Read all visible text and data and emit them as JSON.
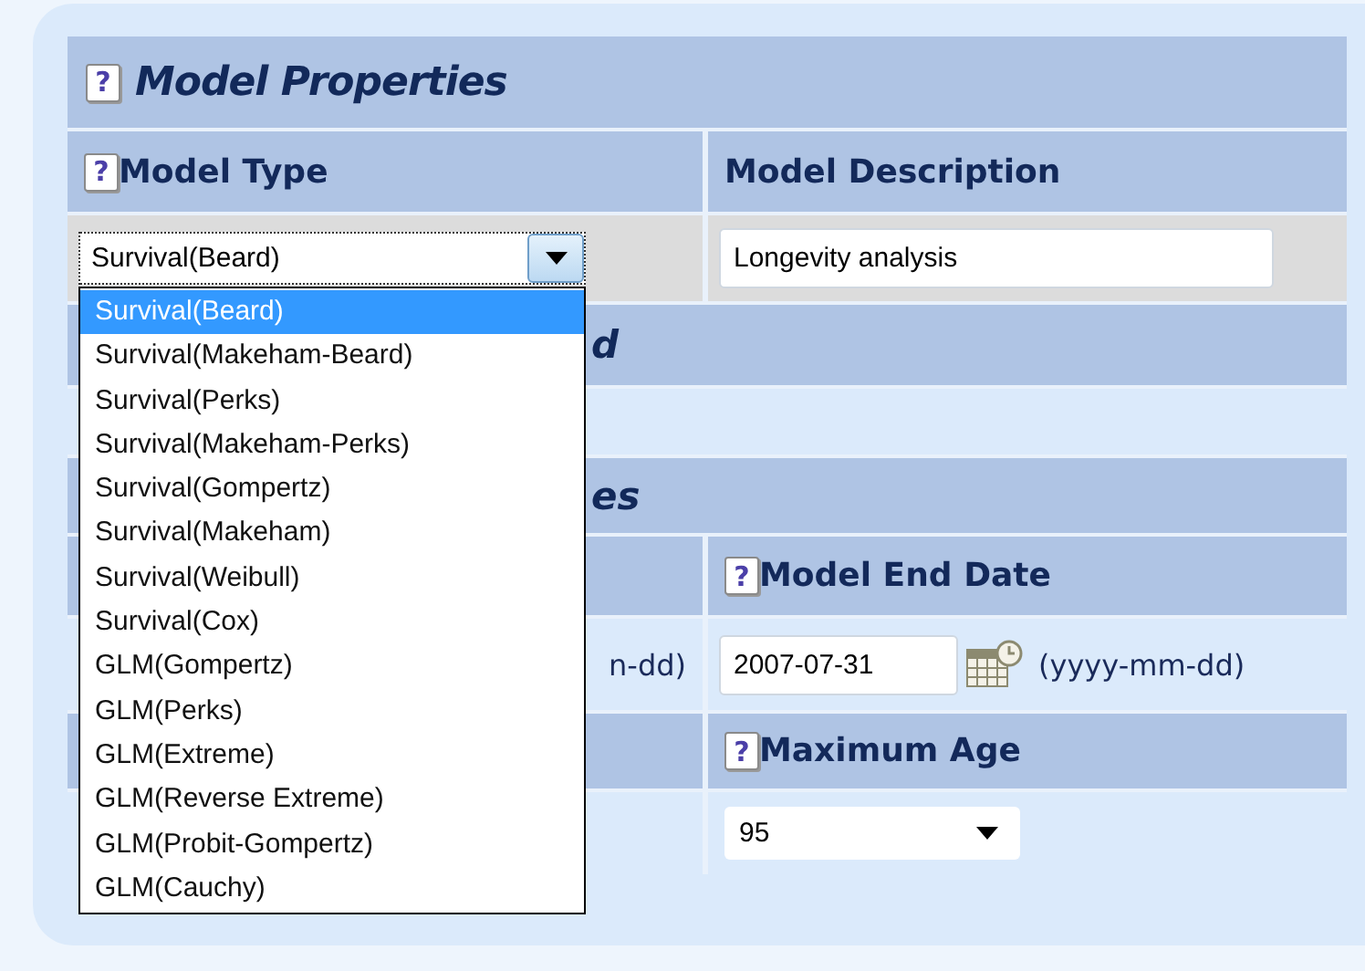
{
  "panel": {
    "help": "?",
    "title": "Model Properties"
  },
  "model_type": {
    "help": "?",
    "label": "Model Type",
    "value": "Survival(Beard)",
    "options": [
      {
        "label": "Survival(Beard)",
        "selected": true
      },
      {
        "label": "Survival(Makeham-Beard)",
        "selected": false
      },
      {
        "label": "Survival(Perks)",
        "selected": false
      },
      {
        "label": "Survival(Makeham-Perks)",
        "selected": false
      },
      {
        "label": "Survival(Gompertz)",
        "selected": false
      },
      {
        "label": "Survival(Makeham)",
        "selected": false
      },
      {
        "label": "Survival(Weibull)",
        "selected": false
      },
      {
        "label": "Survival(Cox)",
        "selected": false
      },
      {
        "label": "GLM(Gompertz)",
        "selected": false
      },
      {
        "label": "GLM(Perks)",
        "selected": false
      },
      {
        "label": "GLM(Extreme)",
        "selected": false
      },
      {
        "label": "GLM(Reverse Extreme)",
        "selected": false
      },
      {
        "label": "GLM(Probit-Gompertz)",
        "selected": false
      },
      {
        "label": "GLM(Cauchy)",
        "selected": false
      }
    ]
  },
  "model_description": {
    "label": "Model Description",
    "value": "Longevity analysis"
  },
  "section_2": {
    "title": "d"
  },
  "section_3": {
    "title": "es"
  },
  "start_date": {
    "format_hint": "n-dd)"
  },
  "end_date": {
    "help": "?",
    "label": "Model End Date",
    "value": "2007-07-31",
    "format_hint": "(yyyy-mm-dd)"
  },
  "maximum_age": {
    "help": "?",
    "label": "Maximum Age",
    "value": "95"
  }
}
